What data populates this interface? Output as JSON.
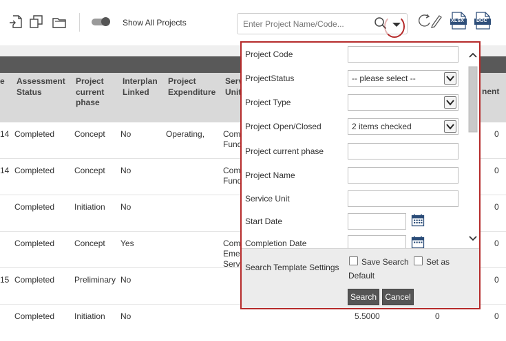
{
  "toolbar": {
    "show_all_label": "Show All Projects",
    "search_placeholder": "Enter Project Name/Code...",
    "export_xlsx_label": "XLSX",
    "export_doc_label": "DOC"
  },
  "table": {
    "headers": {
      "col0": "e",
      "assessment": [
        "Assessment",
        "Status"
      ],
      "phase": [
        "Project",
        "current",
        "phase"
      ],
      "interplan": [
        "Interplan",
        "Linked"
      ],
      "expenditure": [
        "Project",
        "Expenditure"
      ],
      "service": [
        "Serv",
        "Unit"
      ],
      "last": "nent"
    },
    "rows": [
      {
        "c0": "14",
        "status": "Completed",
        "phase": "Concept",
        "linked": "No",
        "expenditure": "Operating,",
        "service": [
          "Com",
          "Fund"
        ],
        "v1": "",
        "v2": "",
        "last": "0"
      },
      {
        "c0": "14",
        "status": "Completed",
        "phase": "Concept",
        "linked": "No",
        "expenditure": "",
        "service": [
          "Com",
          "Fund"
        ],
        "v1": "",
        "v2": "",
        "last": "0"
      },
      {
        "c0": "",
        "status": "Completed",
        "phase": "Initiation",
        "linked": "No",
        "expenditure": "",
        "service": [
          "",
          ""
        ],
        "v1": "",
        "v2": "",
        "last": "0"
      },
      {
        "c0": "",
        "status": "Completed",
        "phase": "Concept",
        "linked": "Yes",
        "expenditure": "",
        "service": [
          "Com",
          "Eme",
          "Servi"
        ],
        "v1": "",
        "v2": "",
        "last": "0"
      },
      {
        "c0": "15",
        "status": "Completed",
        "phase": "Preliminary",
        "linked": "No",
        "expenditure": "",
        "service": [
          "",
          ""
        ],
        "v1": "",
        "v2": "",
        "last": "0"
      },
      {
        "c0": "",
        "status": "Completed",
        "phase": "Initiation",
        "linked": "No",
        "expenditure": "",
        "service": [
          "",
          ""
        ],
        "v1": "5.5000",
        "v2": "0",
        "last": "0"
      }
    ]
  },
  "panel": {
    "fields": {
      "project_code": "Project Code",
      "project_status": "ProjectStatus",
      "project_status_value": "-- please select --",
      "project_type": "Project Type",
      "project_type_value": "",
      "open_closed": "Project Open/Closed",
      "open_closed_value": "2 items checked",
      "current_phase": "Project current phase",
      "project_name": "Project Name",
      "service_unit": "Service Unit",
      "start_date": "Start Date",
      "completion_date": "Completion Date"
    },
    "template_label": "Search Template Settings",
    "save_search_label": "Save Search",
    "set_as_label": "Set as",
    "default_label": "Default",
    "search_button": "Search",
    "cancel_button": "Cancel"
  },
  "colors": {
    "highlight_border": "#b52a2a",
    "header_bar": "#595959",
    "header_row": "#d9d9d9",
    "button_bg": "#555555"
  }
}
